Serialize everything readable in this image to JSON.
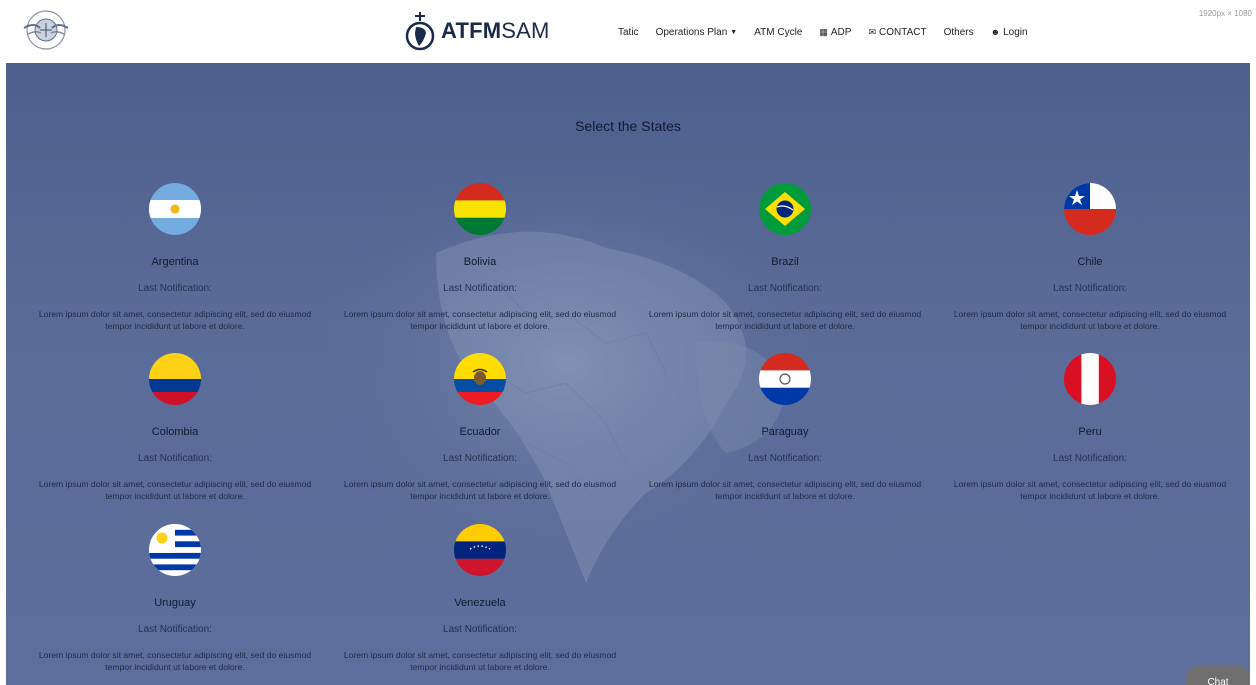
{
  "header": {
    "brand_bold": "ATFM",
    "brand_light": "SAM",
    "resolution_note": "1920px × 1080",
    "nav": [
      {
        "label": "Tatic",
        "icon": "",
        "caret": false
      },
      {
        "label": "Operations Plan",
        "icon": "",
        "caret": true
      },
      {
        "label": "ATM Cycle",
        "icon": "",
        "caret": false
      },
      {
        "label": "ADP",
        "icon": "grid-icon",
        "caret": false
      },
      {
        "label": "CONTACT",
        "icon": "envelope-icon",
        "caret": false
      },
      {
        "label": "Others",
        "icon": "",
        "caret": false
      },
      {
        "label": "Login",
        "icon": "user-icon",
        "caret": false
      }
    ]
  },
  "main": {
    "title": "Select the States",
    "notification_label": "Last Notification:",
    "description": "Lorem ipsum dolor sit amet, consectetur adipiscing elit, sed do eiusmod tempor incididunt ut labore et dolore.",
    "states": [
      {
        "name": "Argentina",
        "flag": "argentina-flag"
      },
      {
        "name": "Bolivia",
        "flag": "bolivia-flag"
      },
      {
        "name": "Brazil",
        "flag": "brazil-flag"
      },
      {
        "name": "Chile",
        "flag": "chile-flag"
      },
      {
        "name": "Colombia",
        "flag": "colombia-flag"
      },
      {
        "name": "Ecuador",
        "flag": "ecuador-flag"
      },
      {
        "name": "Paraguay",
        "flag": "paraguay-flag"
      },
      {
        "name": "Peru",
        "flag": "peru-flag"
      },
      {
        "name": "Uruguay",
        "flag": "uruguay-flag"
      },
      {
        "name": "Venezuela",
        "flag": "venezuela-flag"
      }
    ]
  },
  "chat": {
    "label": "Chat"
  },
  "colors": {
    "hero_top": "#4d5f8c",
    "hero_bottom": "#5d6e9c",
    "brand_text": "#1a2a4a"
  }
}
